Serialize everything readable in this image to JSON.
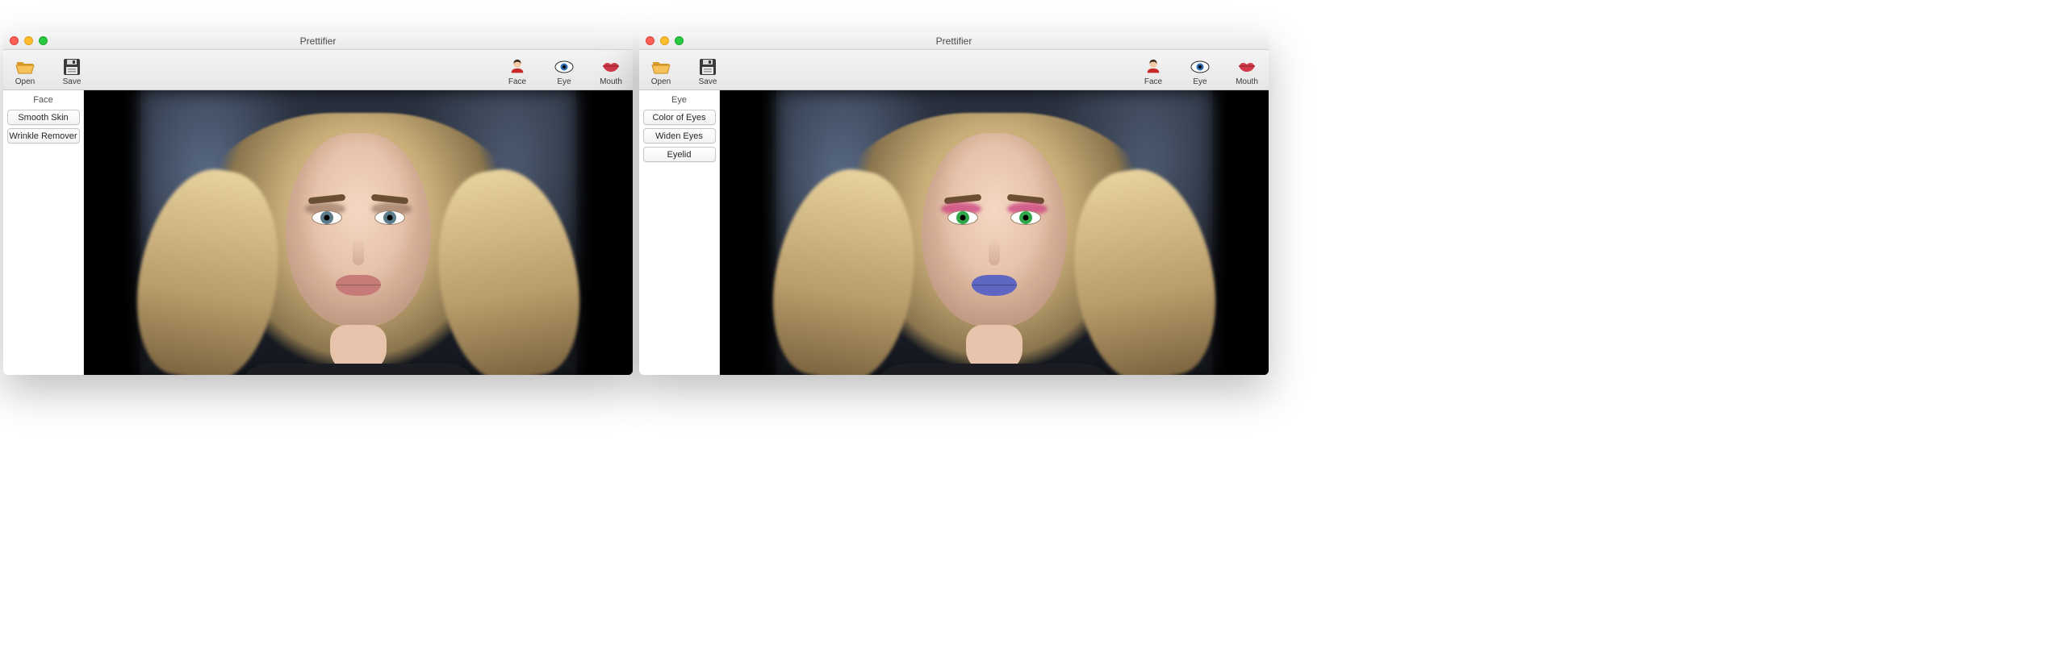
{
  "windows": [
    {
      "title": "Prettifier",
      "toolbar": {
        "open": "Open",
        "save": "Save",
        "face": "Face",
        "eye": "Eye",
        "mouth": "Mouth"
      },
      "sidebar": {
        "header": "Face",
        "items": [
          "Smooth Skin",
          "Wrinkle Remover"
        ]
      },
      "portrait": {
        "iris_color": "#5a7b8a",
        "eyeshadow_color": "rgba(110,80,60,0.45)",
        "lip_color": "#c77b78"
      }
    },
    {
      "title": "Prettifier",
      "toolbar": {
        "open": "Open",
        "save": "Save",
        "face": "Face",
        "eye": "Eye",
        "mouth": "Mouth"
      },
      "sidebar": {
        "header": "Eye",
        "items": [
          "Color of Eyes",
          "Widen Eyes",
          "Eyelid"
        ]
      },
      "portrait": {
        "iris_color": "#2fa84a",
        "eyeshadow_color": "rgba(200,40,120,0.65)",
        "lip_color": "#5d66c0"
      }
    }
  ]
}
